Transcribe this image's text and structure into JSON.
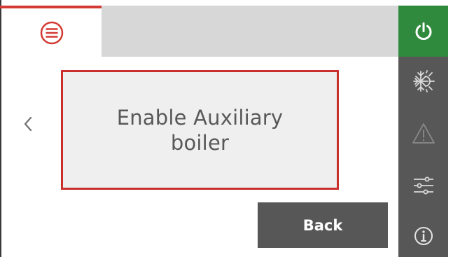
{
  "message": {
    "text": "Enable Auxiliary boiler"
  },
  "buttons": {
    "back_label": "Back"
  },
  "sidebar": {
    "items": [
      {
        "icon": "power-icon"
      },
      {
        "icon": "heat-cool-icon"
      },
      {
        "icon": "warning-icon"
      },
      {
        "icon": "settings-sliders-icon"
      },
      {
        "icon": "info-icon"
      }
    ]
  },
  "header": {
    "menu_icon": "menu-icon"
  },
  "colors": {
    "accent_red": "#d33a34",
    "border_red": "#c9302c",
    "rail_gray": "#575757",
    "power_green": "#2f8a3d",
    "header_gray": "#d7d7d7",
    "panel_bg": "#efefef",
    "text_gray": "#585858"
  }
}
